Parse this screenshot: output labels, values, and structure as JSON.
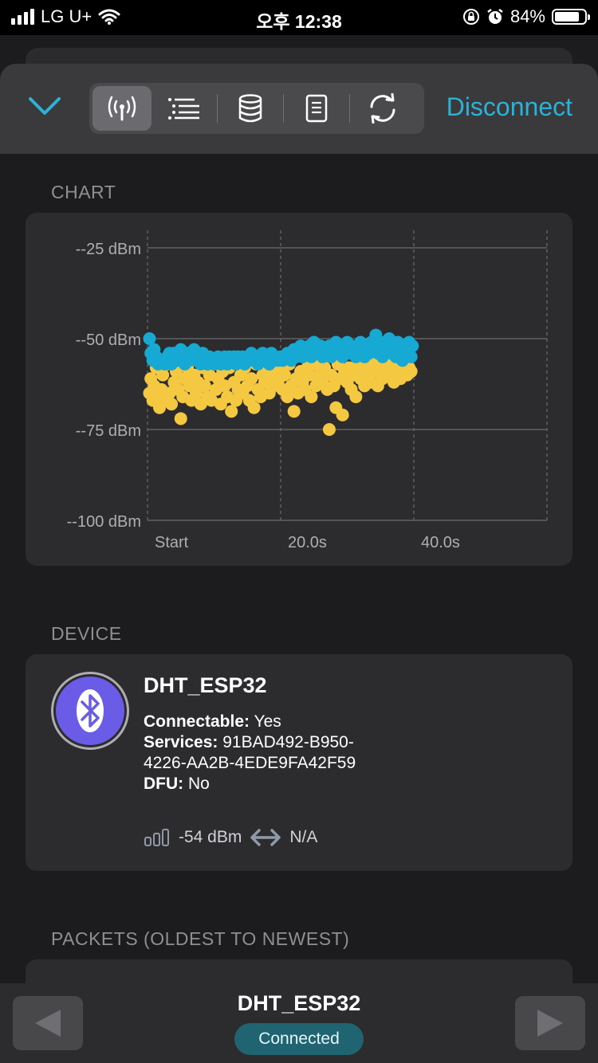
{
  "status_bar": {
    "carrier": "LG U+",
    "time": "오후 12:38",
    "battery_pct": "84%",
    "battery_level": 0.84
  },
  "toolbar": {
    "tabs": [
      "signal-tab",
      "list-tab",
      "database-tab",
      "document-tab",
      "refresh-tab"
    ],
    "active_tab": 0,
    "disconnect_label": "Disconnect"
  },
  "chart_section": {
    "label": "CHART"
  },
  "chart_data": {
    "type": "scatter",
    "y_tick_labels": [
      "--25 dBm",
      "--50 dBm",
      "--75 dBm",
      "--100 dBm"
    ],
    "y_ticks": [
      -25,
      -50,
      -75,
      -100
    ],
    "ylim": [
      -100,
      -25
    ],
    "x_tick_labels": [
      "Start",
      "20.0s",
      "40.0s"
    ],
    "x_ticks": [
      0,
      20,
      40
    ],
    "xlim": [
      0,
      60
    ],
    "grid": true,
    "series": [
      {
        "color": "#f5c842",
        "points": [
          [
            0.3,
            -65
          ],
          [
            0.5,
            -61
          ],
          [
            0.8,
            -67
          ],
          [
            1.0,
            -63
          ],
          [
            1.3,
            -58
          ],
          [
            1.6,
            -66
          ],
          [
            1.8,
            -69
          ],
          [
            2.1,
            -64
          ],
          [
            2.3,
            -60
          ],
          [
            2.6,
            -67
          ],
          [
            3.0,
            -57
          ],
          [
            3.3,
            -65
          ],
          [
            3.6,
            -68
          ],
          [
            4.0,
            -62
          ],
          [
            4.3,
            -59
          ],
          [
            4.6,
            -64
          ],
          [
            5.0,
            -72
          ],
          [
            5.3,
            -66
          ],
          [
            5.6,
            -61
          ],
          [
            6.0,
            -58
          ],
          [
            6.3,
            -63
          ],
          [
            6.6,
            -67
          ],
          [
            7.0,
            -60
          ],
          [
            7.3,
            -65
          ],
          [
            7.6,
            -62
          ],
          [
            8.0,
            -68
          ],
          [
            8.3,
            -58
          ],
          [
            8.6,
            -63
          ],
          [
            9.0,
            -66
          ],
          [
            9.3,
            -60
          ],
          [
            9.6,
            -67
          ],
          [
            10.0,
            -57
          ],
          [
            10.3,
            -64
          ],
          [
            10.6,
            -61
          ],
          [
            11.0,
            -68
          ],
          [
            11.3,
            -59
          ],
          [
            11.6,
            -63
          ],
          [
            12.0,
            -66
          ],
          [
            12.3,
            -58
          ],
          [
            12.6,
            -70
          ],
          [
            13.0,
            -62
          ],
          [
            13.3,
            -67
          ],
          [
            13.6,
            -64
          ],
          [
            14.0,
            -60
          ],
          [
            14.3,
            -65
          ],
          [
            14.6,
            -58
          ],
          [
            15.0,
            -63
          ],
          [
            15.3,
            -67
          ],
          [
            15.6,
            -61
          ],
          [
            16.0,
            -69
          ],
          [
            16.3,
            -57
          ],
          [
            16.6,
            -64
          ],
          [
            17.0,
            -66
          ],
          [
            17.3,
            -60
          ],
          [
            17.6,
            -62
          ],
          [
            18.0,
            -58
          ],
          [
            18.3,
            -65
          ],
          [
            18.6,
            -61
          ],
          [
            19.0,
            -63
          ],
          [
            19.3,
            -59
          ],
          [
            19.6,
            -62
          ],
          [
            20.0,
            -58
          ],
          [
            20.3,
            -64
          ],
          [
            20.6,
            -60
          ],
          [
            21.0,
            -66
          ],
          [
            21.3,
            -57
          ],
          [
            21.6,
            -63
          ],
          [
            22.0,
            -70
          ],
          [
            22.3,
            -61
          ],
          [
            22.6,
            -65
          ],
          [
            23.0,
            -59
          ],
          [
            23.3,
            -62
          ],
          [
            23.6,
            -64
          ],
          [
            24.0,
            -58
          ],
          [
            24.3,
            -60
          ],
          [
            24.6,
            -66
          ],
          [
            25.0,
            -57
          ],
          [
            25.3,
            -63
          ],
          [
            25.6,
            -61
          ],
          [
            26.0,
            -59
          ],
          [
            26.3,
            -62
          ],
          [
            26.6,
            -58
          ],
          [
            27.0,
            -64
          ],
          [
            27.3,
            -75
          ],
          [
            27.6,
            -60
          ],
          [
            28.0,
            -63
          ],
          [
            28.3,
            -69
          ],
          [
            28.6,
            -57
          ],
          [
            29.0,
            -61
          ],
          [
            29.3,
            -71
          ],
          [
            29.6,
            -59
          ],
          [
            30.0,
            -62
          ],
          [
            30.3,
            -58
          ],
          [
            30.6,
            -64
          ],
          [
            31.0,
            -60
          ],
          [
            31.3,
            -66
          ],
          [
            31.6,
            -57
          ],
          [
            32.0,
            -61
          ],
          [
            32.3,
            -59
          ],
          [
            32.6,
            -63
          ],
          [
            33.0,
            -58
          ],
          [
            33.3,
            -60
          ],
          [
            33.6,
            -62
          ],
          [
            34.0,
            -57
          ],
          [
            34.3,
            -59
          ],
          [
            34.6,
            -63
          ],
          [
            35.0,
            -58
          ],
          [
            35.3,
            -61
          ],
          [
            35.6,
            -59
          ],
          [
            36.0,
            -57
          ],
          [
            36.3,
            -60
          ],
          [
            36.6,
            -58
          ],
          [
            37.0,
            -62
          ],
          [
            37.3,
            -57
          ],
          [
            37.6,
            -59
          ],
          [
            38.0,
            -61
          ],
          [
            38.3,
            -58
          ],
          [
            38.6,
            -57
          ],
          [
            39.0,
            -60
          ],
          [
            39.3,
            -58
          ],
          [
            39.6,
            -59
          ]
        ]
      },
      {
        "color": "#16a9d4",
        "points": [
          [
            0.3,
            -50
          ],
          [
            0.5,
            -54
          ],
          [
            0.8,
            -56
          ],
          [
            1.0,
            -53
          ],
          [
            1.3,
            -55
          ],
          [
            1.6,
            -57
          ],
          [
            2.1,
            -56
          ],
          [
            2.6,
            -57
          ],
          [
            3.0,
            -55
          ],
          [
            3.3,
            -54
          ],
          [
            3.6,
            -57
          ],
          [
            4.0,
            -54
          ],
          [
            4.3,
            -55
          ],
          [
            4.6,
            -56
          ],
          [
            5.0,
            -53
          ],
          [
            5.3,
            -55
          ],
          [
            5.6,
            -57
          ],
          [
            6.0,
            -54
          ],
          [
            6.3,
            -56
          ],
          [
            6.6,
            -55
          ],
          [
            7.0,
            -53
          ],
          [
            7.3,
            -56
          ],
          [
            7.6,
            -55
          ],
          [
            8.0,
            -57
          ],
          [
            8.3,
            -54
          ],
          [
            8.6,
            -56
          ],
          [
            9.0,
            -57
          ],
          [
            9.3,
            -55
          ],
          [
            10.0,
            -57
          ],
          [
            10.3,
            -56
          ],
          [
            10.6,
            -55
          ],
          [
            11.0,
            -57
          ],
          [
            11.3,
            -56
          ],
          [
            11.6,
            -55
          ],
          [
            12.0,
            -57
          ],
          [
            12.3,
            -55
          ],
          [
            12.6,
            -56
          ],
          [
            13.0,
            -55
          ],
          [
            13.3,
            -57
          ],
          [
            13.6,
            -55
          ],
          [
            14.0,
            -56
          ],
          [
            14.3,
            -55
          ],
          [
            14.6,
            -57
          ],
          [
            15.0,
            -55
          ],
          [
            15.3,
            -56
          ],
          [
            15.6,
            -54
          ],
          [
            16.0,
            -56
          ],
          [
            16.3,
            -55
          ],
          [
            16.6,
            -57
          ],
          [
            17.0,
            -55
          ],
          [
            17.3,
            -54
          ],
          [
            17.6,
            -56
          ],
          [
            18.0,
            -55
          ],
          [
            18.3,
            -57
          ],
          [
            18.6,
            -54
          ],
          [
            19.0,
            -56
          ],
          [
            19.3,
            -55
          ],
          [
            19.6,
            -56
          ],
          [
            20.0,
            -55
          ],
          [
            20.3,
            -56
          ],
          [
            21.0,
            -54
          ],
          [
            21.3,
            -55
          ],
          [
            21.6,
            -56
          ],
          [
            22.0,
            -53
          ],
          [
            22.3,
            -55
          ],
          [
            22.6,
            -54
          ],
          [
            23.0,
            -52
          ],
          [
            23.3,
            -55
          ],
          [
            23.6,
            -53
          ],
          [
            24.0,
            -54
          ],
          [
            24.3,
            -52
          ],
          [
            24.6,
            -55
          ],
          [
            25.0,
            -51
          ],
          [
            25.3,
            -53
          ],
          [
            25.6,
            -54
          ],
          [
            26.0,
            -52
          ],
          [
            26.3,
            -55
          ],
          [
            26.6,
            -53
          ],
          [
            27.0,
            -54
          ],
          [
            27.3,
            -52
          ],
          [
            27.6,
            -55
          ],
          [
            28.0,
            -53
          ],
          [
            28.3,
            -51
          ],
          [
            28.6,
            -54
          ],
          [
            29.0,
            -52
          ],
          [
            29.3,
            -55
          ],
          [
            29.6,
            -53
          ],
          [
            30.0,
            -51
          ],
          [
            30.3,
            -54
          ],
          [
            30.6,
            -52
          ],
          [
            31.0,
            -53
          ],
          [
            31.3,
            -55
          ],
          [
            31.6,
            -52
          ],
          [
            32.0,
            -51
          ],
          [
            32.3,
            -53
          ],
          [
            32.6,
            -55
          ],
          [
            33.0,
            -52
          ],
          [
            33.3,
            -54
          ],
          [
            33.6,
            -51
          ],
          [
            34.0,
            -53
          ],
          [
            34.3,
            -49
          ],
          [
            34.6,
            -54
          ],
          [
            35.0,
            -52
          ],
          [
            35.3,
            -55
          ],
          [
            35.6,
            -51
          ],
          [
            36.0,
            -53
          ],
          [
            36.3,
            -50
          ],
          [
            36.6,
            -54
          ],
          [
            37.0,
            -52
          ],
          [
            37.3,
            -55
          ],
          [
            37.6,
            -51
          ],
          [
            38.0,
            -53
          ],
          [
            38.3,
            -56
          ],
          [
            38.6,
            -52
          ],
          [
            39.0,
            -54
          ],
          [
            39.3,
            -51
          ],
          [
            39.6,
            -55
          ],
          [
            39.8,
            -52
          ]
        ]
      }
    ]
  },
  "device_section": {
    "label": "DEVICE"
  },
  "device": {
    "name": "DHT_ESP32",
    "connectable_label": "Connectable:",
    "connectable_value": "Yes",
    "services_label": "Services:",
    "services_value_1": "91BAD492-B950-",
    "services_value_2": "4226-AA2B-4EDE9FA42F59",
    "dfu_label": "DFU:",
    "dfu_value": "No",
    "rssi": "-54 dBm",
    "tx_power": "N/A",
    "avatar_icon": "bluetooth-icon",
    "avatar_color": "#6a5ce6"
  },
  "packets_section": {
    "label": "PACKETS (OLDEST TO NEWEST)"
  },
  "bottom_bar": {
    "device_name": "DHT_ESP32",
    "status": "Connected"
  }
}
